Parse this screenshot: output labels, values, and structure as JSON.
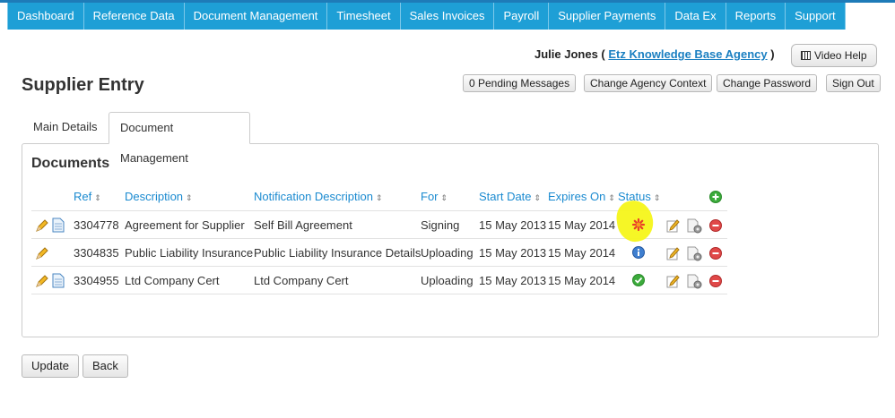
{
  "nav": {
    "items": [
      "Dashboard",
      "Reference Data",
      "Document Management",
      "Timesheet",
      "Sales Invoices",
      "Payroll",
      "Supplier Payments",
      "Data Ex",
      "Reports",
      "Support"
    ]
  },
  "header": {
    "user_name": "Julie Jones (",
    "agency_link": "Etz Knowledge Base Agency",
    "user_suffix": ")",
    "video_help": "Video Help",
    "buttons": {
      "pending": "0 Pending Messages",
      "change_agency": "Change Agency Context",
      "change_password": "Change Password",
      "sign_out": "Sign Out"
    }
  },
  "page": {
    "title": "Supplier Entry"
  },
  "tabs": [
    "Main Details",
    "Document Management"
  ],
  "documents": {
    "title": "Documents",
    "columns": [
      "Ref",
      "Description",
      "Notification Description",
      "For",
      "Start Date",
      "Expires On",
      "Status"
    ],
    "rows": [
      {
        "ref": "3304778",
        "description": "Agreement for Supplier",
        "notification": "Self Bill Agreement",
        "for": "Signing",
        "start": "15 May 2013",
        "expires": "15 May 2014",
        "status_icon": "pending-star-icon"
      },
      {
        "ref": "3304835",
        "description": "Public Liability Insurance",
        "notification": "Public Liability Insurance Details",
        "for": "Uploading",
        "start": "15 May 2013",
        "expires": "15 May 2014",
        "status_icon": "info-icon"
      },
      {
        "ref": "3304955",
        "description": "Ltd Company Cert",
        "notification": "Ltd Company Cert",
        "for": "Uploading",
        "start": "15 May 2013",
        "expires": "15 May 2014",
        "status_icon": "check-icon"
      }
    ]
  },
  "footer": {
    "update": "Update",
    "back": "Back"
  },
  "colors": {
    "nav": "#1e9fd6",
    "link": "#1a8ad0",
    "highlight": "#f5f51a"
  }
}
